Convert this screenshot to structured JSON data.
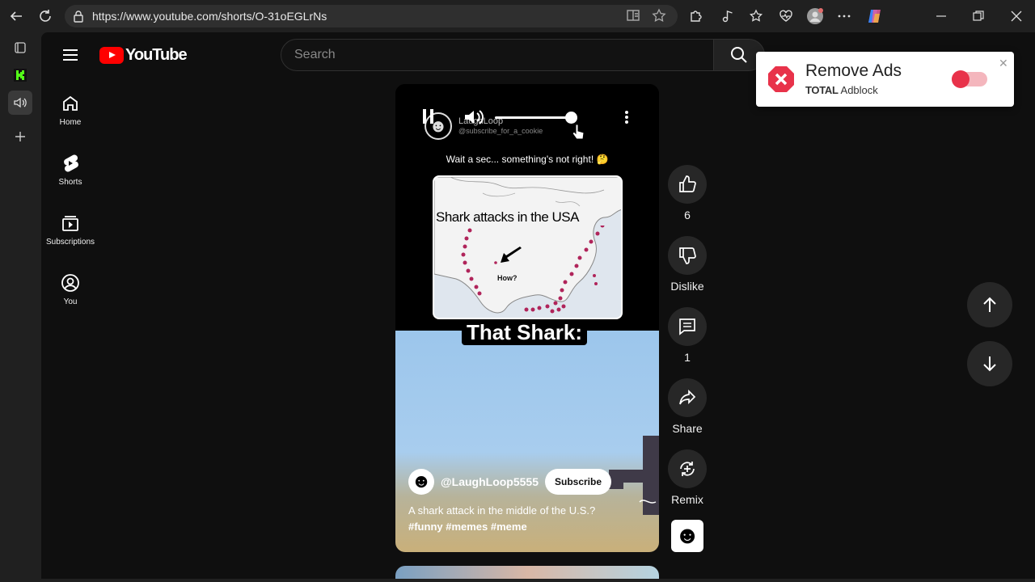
{
  "browser": {
    "url": "https://www.youtube.com/shorts/O-31oEGLrNs"
  },
  "youtube": {
    "logo_text": "YouTube",
    "search_placeholder": "Search",
    "sidebar": [
      {
        "label": "Home",
        "icon": "home-icon"
      },
      {
        "label": "Shorts",
        "icon": "shorts-icon"
      },
      {
        "label": "Subscriptions",
        "icon": "subscriptions-icon"
      },
      {
        "label": "You",
        "icon": "user-icon"
      }
    ]
  },
  "short": {
    "overlay_channel_name": "LaughLoop",
    "overlay_channel_handle": "@subscribe_for_a_cookie",
    "caption_question": "Wait a sec... something's not right! 🤔",
    "map_title": "Shark attacks in the USA",
    "map_label": "How?",
    "banner_text": "That Shark:",
    "channel_handle": "@LaughLoop5555",
    "subscribe_label": "Subscribe",
    "description": "A shark attack in the middle of the U.S.?",
    "hashtags": "#funny #memes #meme"
  },
  "actions": {
    "like_count": "6",
    "dislike_label": "Dislike",
    "comment_count": "1",
    "share_label": "Share",
    "remix_label": "Remix"
  },
  "adblock_popup": {
    "title": "Remove Ads",
    "brand_bold": "TOTAL",
    "brand_rest": " Adblock",
    "toggle_color": "#e8324a"
  }
}
